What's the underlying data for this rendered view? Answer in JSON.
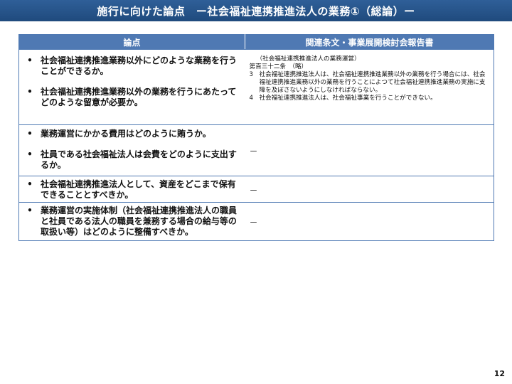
{
  "title": "施行に向けた論点　ー社会福祉連携推進法人の業務①（総論）ー",
  "table": {
    "headers": {
      "left": "論点",
      "right": "関連条文・事業展開検討会報告書"
    },
    "bullet_symbol": "•",
    "rows": [
      {
        "issues": [
          "社会福祉連携推進業務以外にどのような業務を行うことができるか。",
          "社会福祉連携推進業務以外の業務を行うにあたってどのような留意が必要か。"
        ],
        "ref": {
          "heading": "（社会福祉連携推進法人の業務運営）",
          "article": "第百三十二条　（略）",
          "items": [
            {
              "num": "3",
              "text": "社会福祉連携推進法人は、社会福祉連携推進業務以外の業務を行う場合には、社会福祉連携推進業務以外の業務を行うことによつて社会福祉連携推進業務の実施に支障を及ぼさないようにしなければならない。"
            },
            {
              "num": "4",
              "text": "社会福祉連携推進法人は、社会福祉事業を行うことができない。"
            }
          ]
        }
      },
      {
        "issues": [
          "業務運営にかかる費用はどのように賄うか。",
          "社員である社会福祉法人は会費をどのように支出するか。"
        ],
        "ref_text": "－"
      },
      {
        "issues": [
          "社会福祉連携推進法人として、資産をどこまで保有できることとすべきか。"
        ],
        "ref_text": "－"
      },
      {
        "issues": [
          "業務運営の実施体制（社会福祉連携推進法人の職員と社員である法人の職員を兼務する場合の給与等の取扱い等）はどのように整備すべきか。"
        ],
        "ref_text": "－"
      }
    ]
  },
  "page_number": "12",
  "colors": {
    "title_bar": "#1f4a7d",
    "header": "#4f79b3",
    "border": "#4f79b3"
  }
}
